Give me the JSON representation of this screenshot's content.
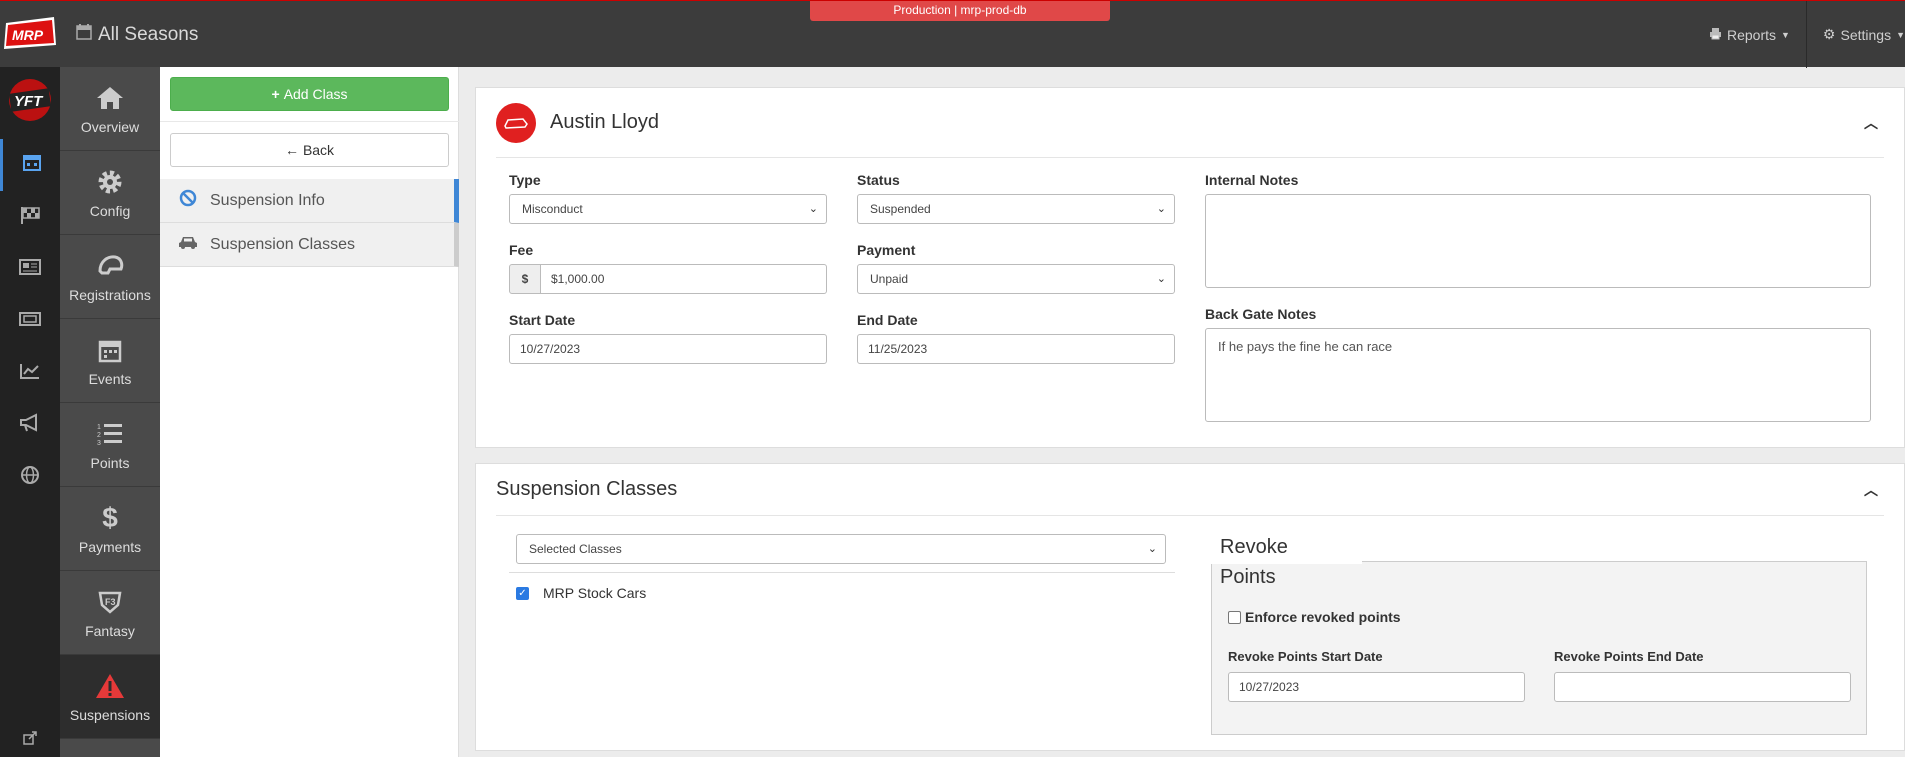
{
  "header": {
    "season_title": "All Seasons",
    "env_badge": "Production | mrp-prod-db",
    "reports_label": "Reports",
    "settings_label": "Settings",
    "logo_text": "MRP",
    "rail_logo_text": "YFT"
  },
  "rail": {
    "icons": [
      "calendar-icon",
      "checkered-flag-icon",
      "newspaper-icon",
      "ticket-icon",
      "chart-icon",
      "megaphone-icon",
      "globe-icon",
      "external-link-icon"
    ]
  },
  "nav": {
    "items": [
      {
        "label": "Overview",
        "icon": "home-icon"
      },
      {
        "label": "Config",
        "icon": "gear-icon"
      },
      {
        "label": "Registrations",
        "icon": "helmet-icon"
      },
      {
        "label": "Events",
        "icon": "calendar-icon"
      },
      {
        "label": "Points",
        "icon": "list-icon"
      },
      {
        "label": "Payments",
        "icon": "dollar-icon"
      },
      {
        "label": "Fantasy",
        "icon": "fantasy-icon"
      },
      {
        "label": "Suspensions",
        "icon": "warning-icon"
      }
    ]
  },
  "subnav": {
    "add_class_label": "Add Class",
    "back_label": "Back",
    "items": [
      {
        "label": "Suspension Info",
        "icon": "ban-icon"
      },
      {
        "label": "Suspension Classes",
        "icon": "car-icon"
      }
    ]
  },
  "suspension": {
    "driver_name": "Austin Lloyd",
    "type_label": "Type",
    "type_value": "Misconduct",
    "status_label": "Status",
    "status_value": "Suspended",
    "fee_label": "Fee",
    "fee_prefix": "$",
    "fee_value": "$1,000.00",
    "payment_label": "Payment",
    "payment_value": "Unpaid",
    "start_label": "Start Date",
    "start_value": "10/27/2023",
    "end_label": "End Date",
    "end_value": "11/25/2023",
    "internal_notes_label": "Internal Notes",
    "internal_notes_value": "",
    "back_gate_label": "Back Gate Notes",
    "back_gate_value": "If he pays the fine he can race"
  },
  "classes": {
    "title": "Suspension Classes",
    "select_value": "Selected Classes",
    "class_items": [
      {
        "label": "MRP Stock Cars",
        "checked": true
      }
    ],
    "revoke_legend": "Revoke Points",
    "enforce_label": "Enforce revoked points",
    "enforce_checked": false,
    "revoke_start_label": "Revoke Points Start Date",
    "revoke_start_value": "10/27/2023",
    "revoke_end_label": "Revoke Points End Date",
    "revoke_end_value": ""
  }
}
